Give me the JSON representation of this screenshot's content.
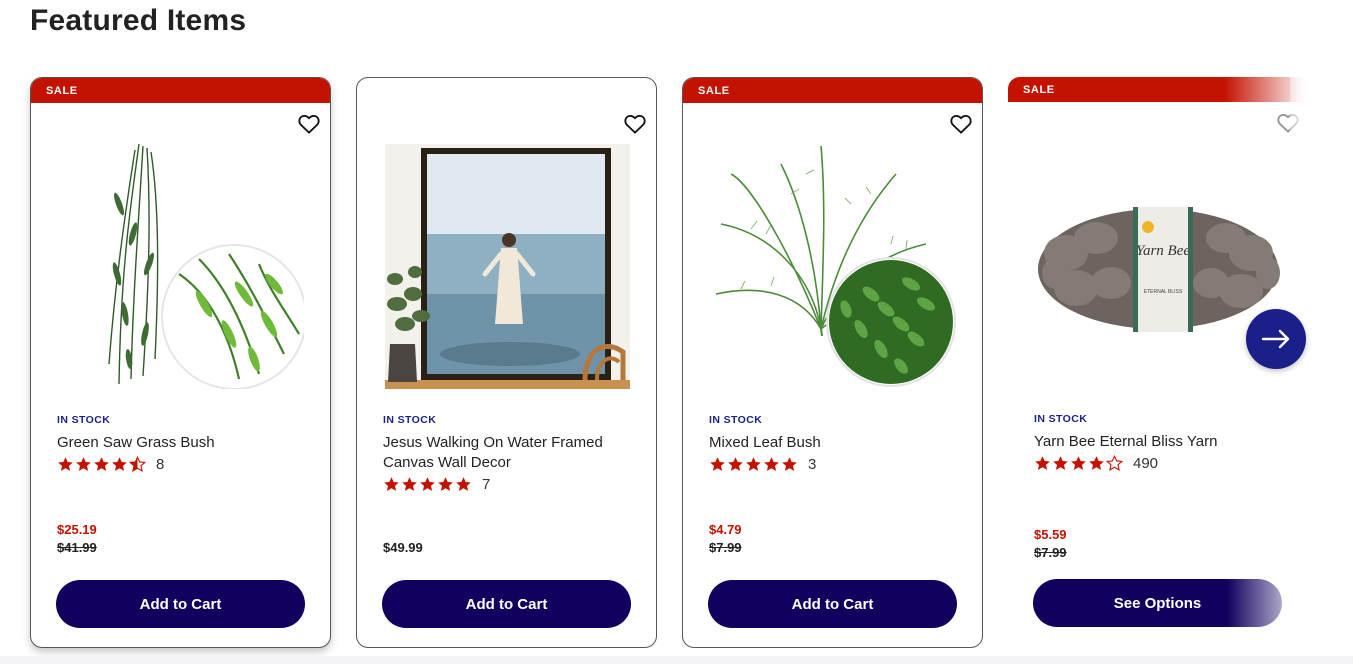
{
  "section": {
    "title": "Featured Items"
  },
  "products": [
    {
      "badge": "SALE",
      "stock": "IN STOCK",
      "name": "Green Saw Grass Bush",
      "rating": 4.5,
      "reviews": "8",
      "sale_price": "$25.19",
      "old_price": "$41.99",
      "button": "Add to Cart",
      "image_icon": "hanging-grass-plant-image"
    },
    {
      "badge": "",
      "stock": "IN STOCK",
      "name": "Jesus Walking On Water Framed Canvas Wall Decor",
      "rating": 5,
      "reviews": "7",
      "price": "$49.99",
      "button": "Add to Cart",
      "image_icon": "framed-canvas-image"
    },
    {
      "badge": "SALE",
      "stock": "IN STOCK",
      "name": "Mixed Leaf Bush",
      "rating": 5,
      "reviews": "3",
      "sale_price": "$4.79",
      "old_price": "$7.99",
      "button": "Add to Cart",
      "image_icon": "fern-bush-image"
    },
    {
      "badge": "SALE",
      "stock": "IN STOCK",
      "name": "Yarn Bee Eternal Bliss Yarn",
      "rating": 4.5,
      "reviews": "490",
      "sale_price": "$5.59",
      "old_price": "$7.99",
      "button": "See Options",
      "image_icon": "yarn-skein-image",
      "label_brand": "Yarn Bee",
      "label_product": "ETERNAL BLISS"
    }
  ],
  "colors": {
    "sale": "#c41200",
    "stock": "#1a1f8a",
    "button": "#12005e",
    "star": "#c41200"
  }
}
